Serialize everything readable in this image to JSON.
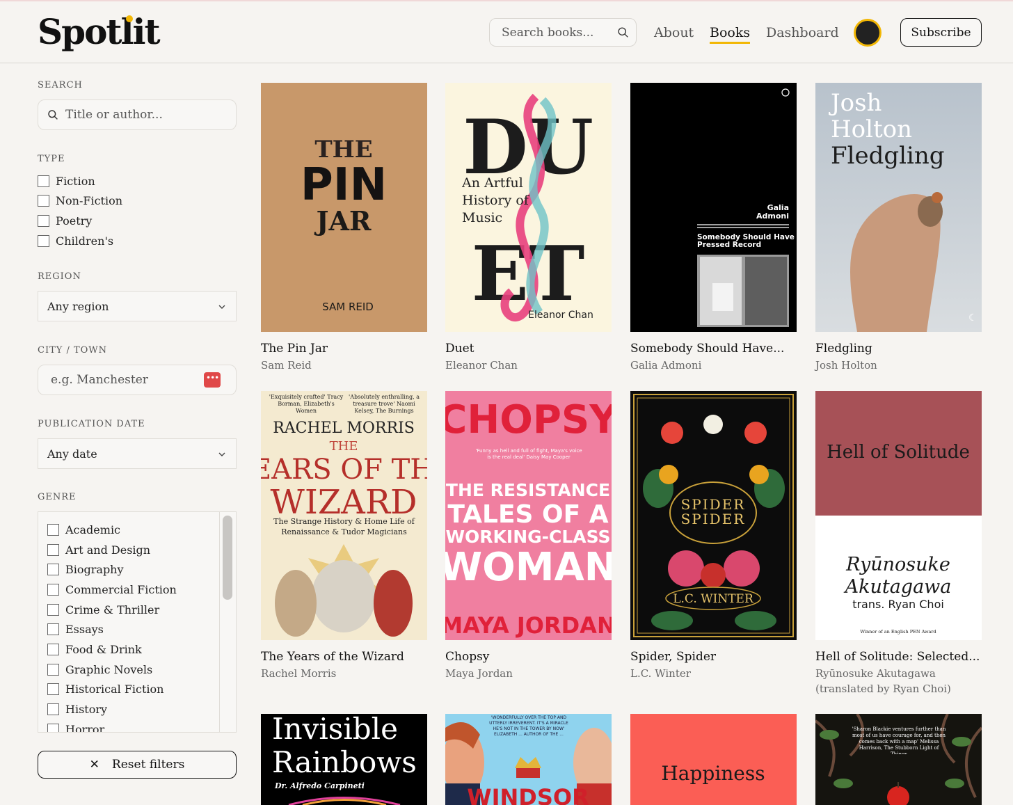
{
  "brand": {
    "name": "Spotlit",
    "accent": "#f2b705"
  },
  "header": {
    "search_placeholder": "Search books...",
    "nav": [
      {
        "label": "About",
        "active": false
      },
      {
        "label": "Books",
        "active": true
      },
      {
        "label": "Dashboard",
        "active": false
      }
    ],
    "subscribe_label": "Subscribe"
  },
  "filters": {
    "search": {
      "label": "SEARCH",
      "placeholder": "Title or author..."
    },
    "type": {
      "label": "TYPE",
      "options": [
        "Fiction",
        "Non-Fiction",
        "Poetry",
        "Children's"
      ]
    },
    "region": {
      "label": "REGION",
      "value": "Any region"
    },
    "city": {
      "label": "CITY / TOWN",
      "placeholder": "e.g. Manchester"
    },
    "date": {
      "label": "PUBLICATION DATE",
      "value": "Any date"
    },
    "genre": {
      "label": "GENRE",
      "options": [
        "Academic",
        "Art and Design",
        "Biography",
        "Commercial Fiction",
        "Crime & Thriller",
        "Essays",
        "Food & Drink",
        "Graphic Novels",
        "Historical Fiction",
        "History",
        "Horror"
      ]
    },
    "reset_label": "Reset filters"
  },
  "books": [
    {
      "title": "The Pin Jar",
      "author": "Sam Reid",
      "cover": {
        "bg": "#c8986a",
        "lines": [
          "THE",
          "PIN",
          "JAR"
        ],
        "byline": "SAM REID"
      }
    },
    {
      "title": "Duet",
      "author": "Eleanor Chan",
      "cover": {
        "bg": "#fbf5df",
        "lines": [
          "DU",
          "ET"
        ],
        "subtitle": "An Artful History of Music",
        "byline": "Eleanor Chan"
      }
    },
    {
      "title": "Somebody Should Have...",
      "author": "Galia Admoni",
      "cover": {
        "bg": "#000000",
        "author_lines": [
          "Galia",
          "Admoni"
        ],
        "title_lines": [
          "Somebody Should Have",
          "Pressed Record"
        ]
      }
    },
    {
      "title": "Fledgling",
      "author": "Josh Holton",
      "cover": {
        "bg": "#c9d0d6",
        "lines": [
          "Josh",
          "Holton",
          "Fledgling"
        ]
      }
    },
    {
      "title": "The Years of the Wizard",
      "author": "Rachel Morris",
      "cover": {
        "bg": "#f4ead0",
        "quotes": [
          "'Exquisitely crafted' Tracy Borman, Elizabeth's Women",
          "'Absolutely enthralling, a treasure trove' Naomi Kelsey, The Burnings"
        ],
        "byline": "RACHEL MORRIS",
        "lines": [
          "THE",
          "YEARS OF THE",
          "WIZARD"
        ],
        "subtitle": "The Strange History & Home Life of Renaissance & Tudor Magicians"
      }
    },
    {
      "title": "Chopsy",
      "author": "Maya Jordan",
      "cover": {
        "bg": "#f07fa0",
        "headline": "CHOPSY",
        "quote": "'Funny as hell and full of fight, Maya's voice is the real deal' Daisy May Cooper",
        "lines": [
          "THE RESISTANCE",
          "TALES OF A",
          "WORKING-CLASS",
          "WOMAN"
        ],
        "byline": "MAYA JORDAN"
      }
    },
    {
      "title": "Spider, Spider",
      "author": "L.C. Winter",
      "cover": {
        "bg": "#0c0c0c",
        "lines": [
          "SPIDER",
          "SPIDER"
        ],
        "byline": "L.C. WINTER"
      }
    },
    {
      "title": "Hell of Solitude: Selected...",
      "author": "Ryūnosuke Akutagawa (translated by Ryan Choi)",
      "cover": {
        "bg_top": "#a75157",
        "headline": "Hell of Solitude",
        "lines": [
          "Ryūnosuke",
          "Akutagawa"
        ],
        "trans": "trans. Ryan Choi",
        "footer": "Winner of an English PEN Award"
      }
    },
    {
      "title": "",
      "author": "",
      "cover": {
        "bg": "#000000",
        "lines": [
          "Invisible",
          "Rainbows"
        ],
        "byline": "Dr. Alfredo Carpineti"
      }
    },
    {
      "title": "",
      "author": "",
      "cover": {
        "bg": "#8fd3ee",
        "quote": "'WONDERFULLY OVER THE TOP AND UTTERLY IRREVERENT. IT'S A MIRACLE HE'S NOT IN THE TOWER BY NOW' ELIZABETH ... AUTHOR OF THE ...",
        "headline": "WINDSOR"
      }
    },
    {
      "title": "",
      "author": "",
      "cover": {
        "bg": "#fb5e55",
        "headline": "Happiness"
      }
    },
    {
      "title": "",
      "author": "",
      "cover": {
        "bg": "#15140f",
        "quote": "'Sharon Blackie ventures further than most of us have courage for, and then comes back with a map' Melissa Harrison, The Stubborn Light of Things"
      }
    }
  ]
}
